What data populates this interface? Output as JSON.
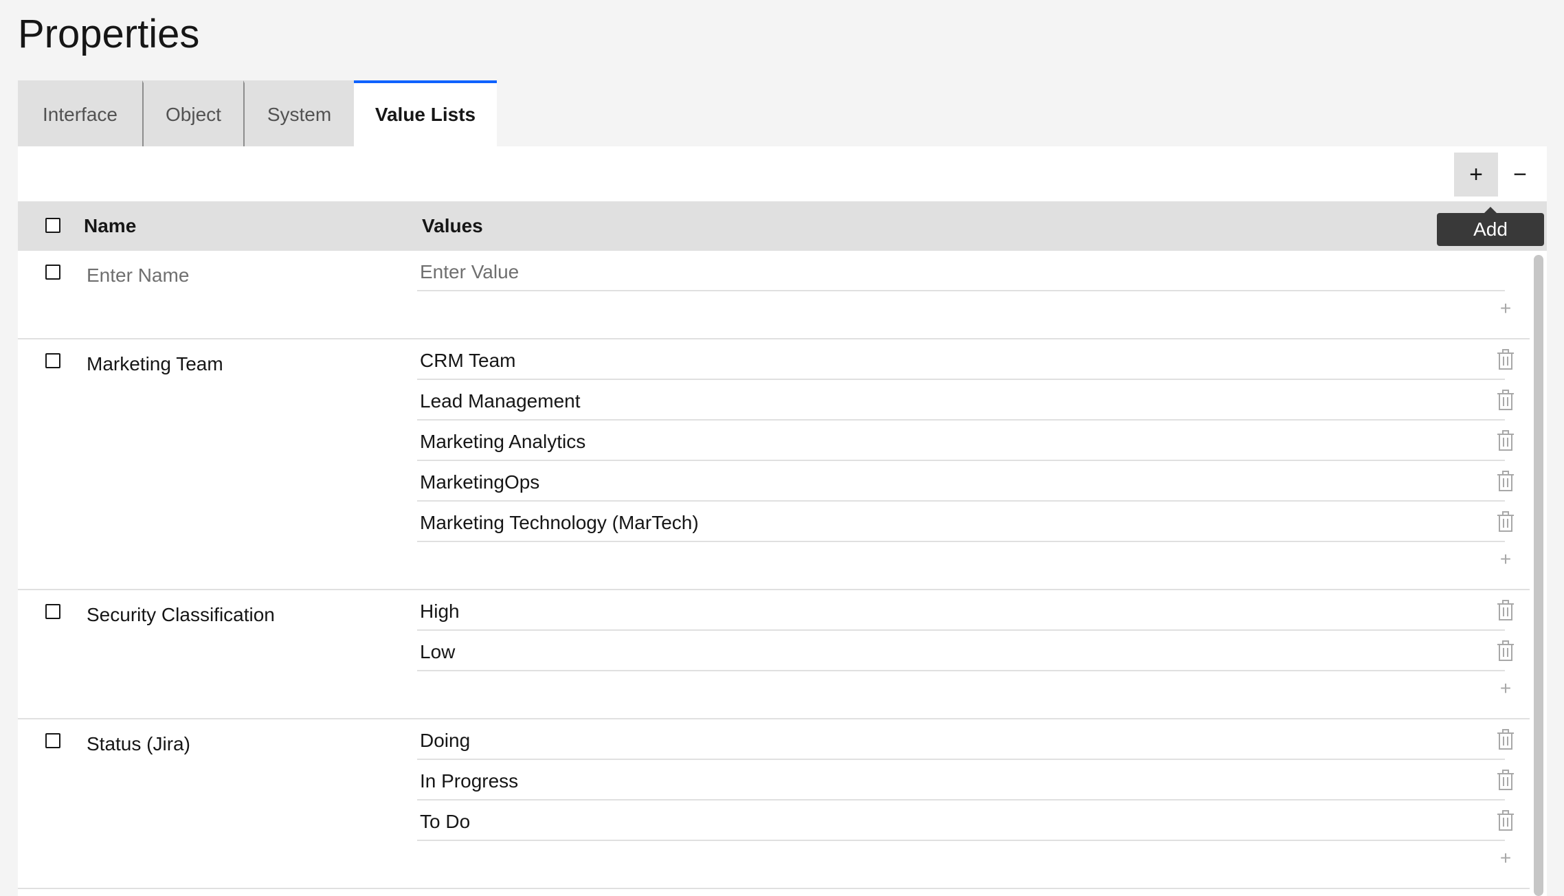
{
  "page": {
    "title": "Properties"
  },
  "tabs": [
    {
      "label": "Interface"
    },
    {
      "label": "Object"
    },
    {
      "label": "System"
    },
    {
      "label": "Value Lists"
    }
  ],
  "active_tab": "Value Lists",
  "toolbar": {
    "add_symbol": "+",
    "remove_symbol": "−",
    "tooltip": "Add"
  },
  "table": {
    "columns": [
      "Name",
      "Values"
    ],
    "new_row": {
      "name_placeholder": "Enter Name",
      "value_placeholder": "Enter Value"
    },
    "groups": [
      {
        "name": "Marketing Team",
        "values": [
          "CRM Team",
          "Lead Management",
          "Marketing Analytics",
          "MarketingOps",
          "Marketing Technology (MarTech)"
        ]
      },
      {
        "name": "Security Classification",
        "values": [
          "High",
          "Low"
        ]
      },
      {
        "name": "Status (Jira)",
        "values": [
          "Doing",
          "In Progress",
          "To Do"
        ]
      }
    ]
  },
  "icons": {
    "trash": "trash-icon",
    "add_value": "plus-icon",
    "accent_color": "#0f62fe"
  }
}
